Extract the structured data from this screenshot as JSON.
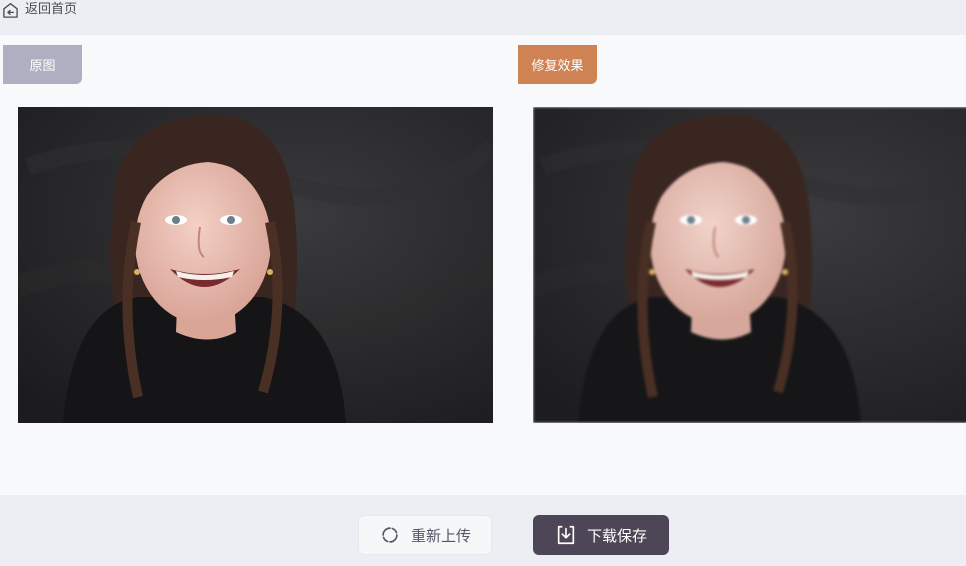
{
  "header": {
    "back_label": "返回首页",
    "back_icon": "home-back-icon"
  },
  "compare": {
    "original_tag": "原图",
    "repaired_tag": "修复效果",
    "original_tag_color": "#aeb0c1",
    "repaired_tag_color": "#cf8354"
  },
  "actions": {
    "reupload_label": "重新上传",
    "download_label": "下载保存",
    "reupload_icon": "refresh-icon",
    "download_icon": "download-icon",
    "download_bg": "#4c4656"
  }
}
